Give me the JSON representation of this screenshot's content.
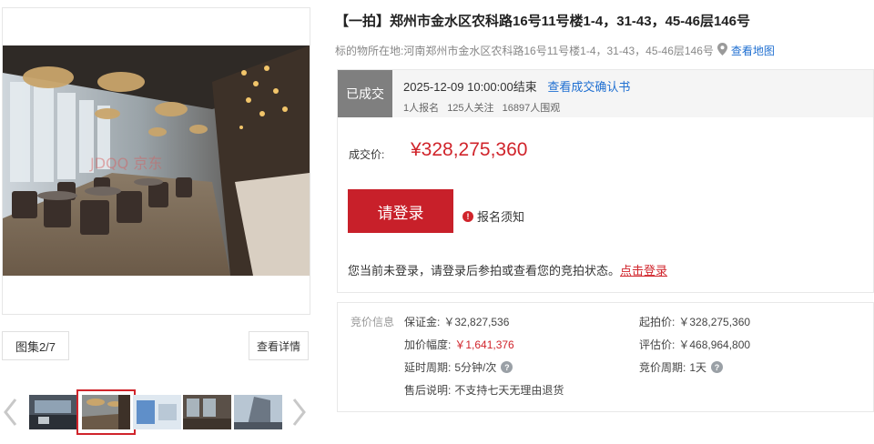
{
  "gallery": {
    "count_label": "图集2/7",
    "detail_button": "查看详情",
    "active_thumb_index": 1,
    "watermark": "JDQQ 京东"
  },
  "listing": {
    "title": "【一拍】郑州市金水区农科路16号11号楼1-4，31-43，45-46层146号",
    "location_label": "标的物所在地:",
    "location_value": "河南郑州市金水区农科路16号11号楼1-4，31-43，45-46层146号",
    "map_link": "查看地图"
  },
  "status": {
    "badge": "已成交",
    "end_time": "2025-12-09 10:00:00结束",
    "confirm_link": "查看成交确认书",
    "signups": "1人报名",
    "followers": "125人关注",
    "viewers": "16897人围观"
  },
  "deal": {
    "label": "成交价:",
    "price": "¥328,275,360",
    "login_button": "请登录",
    "notice_link": "报名须知",
    "login_tip": "您当前未登录，请登录后参拍或查看您的竞拍状态。",
    "login_tip_link": "点击登录"
  },
  "info": {
    "section_title": "竞价信息",
    "deposit_label": "保证金:",
    "deposit_value": "￥32,827,536",
    "increment_label": "加价幅度:",
    "increment_value": "￥1,641,376",
    "extension_label": "延时周期:",
    "extension_value": "5分钟/次",
    "aftersale_label": "售后说明:",
    "aftersale_value": "不支持七天无理由退货",
    "start_price_label": "起拍价:",
    "start_price_value": "￥328,275,360",
    "appraisal_label": "评估价:",
    "appraisal_value": "￥468,964,800",
    "cycle_label": "竞价周期:",
    "cycle_value": "1天"
  },
  "colors": {
    "accent_red": "#d0242b",
    "link_blue": "#1f6fd1",
    "badge_gray": "#7f7f7f"
  }
}
